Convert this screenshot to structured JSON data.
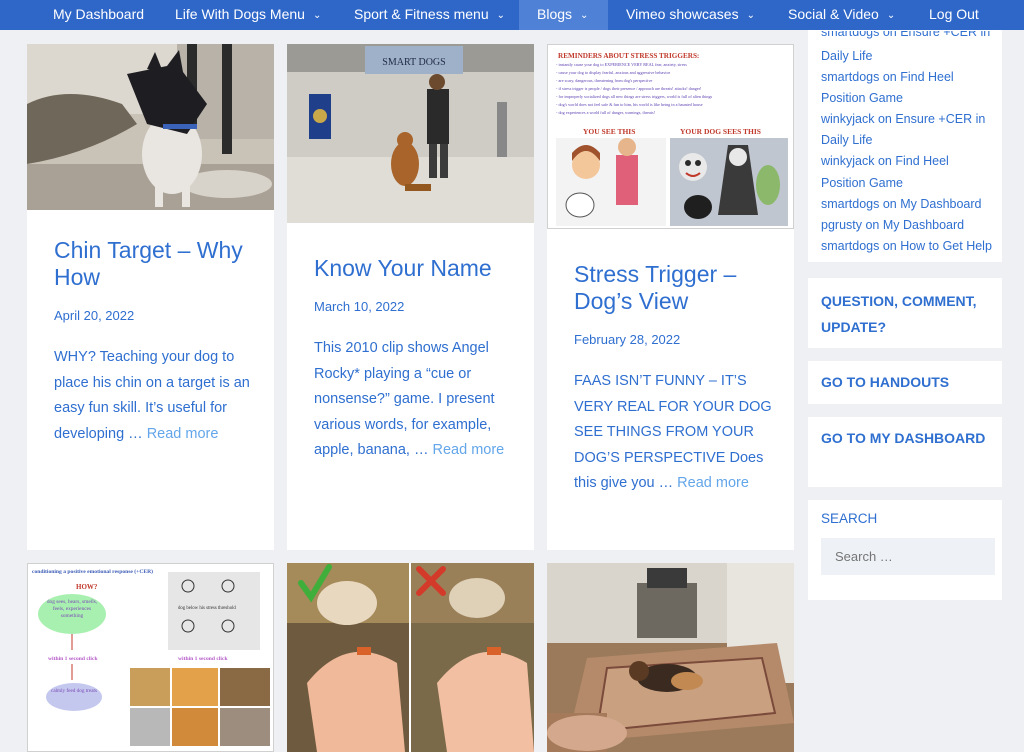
{
  "nav": {
    "items": [
      {
        "label": "My Dashboard"
      },
      {
        "label": "Life With Dogs Menu",
        "dropdown": true
      },
      {
        "label": "Sport & Fitness menu",
        "dropdown": true
      },
      {
        "label": "Blogs",
        "dropdown": true,
        "active": true
      },
      {
        "label": "Vimeo showcases",
        "dropdown": true
      },
      {
        "label": "Social & Video",
        "dropdown": true
      },
      {
        "label": "Log Out"
      }
    ],
    "chevron": "⌄"
  },
  "posts": [
    {
      "title": "Chin Target – Why How",
      "date": "April 20, 2022",
      "excerpt": "WHY? Teaching your dog to place his chin on a target is an easy fun skill. It’s useful for developing … ",
      "read_more": "Read more"
    },
    {
      "title": "Know Your Name",
      "date": "March 10, 2022",
      "excerpt": "This 2010 clip shows Angel Rocky* playing a “cue or nonsense?” game. I present various words, for example, apple, banana, … ",
      "read_more": "Read more",
      "image_text": {
        "sign": "SMART DOGS"
      }
    },
    {
      "title": "Stress Trigger – Dog’s View",
      "date": "February 28, 2022",
      "excerpt": "FAAS ISN’T FUNNY – IT’S VERY REAL FOR YOUR DOG SEE THINGS FROM YOUR DOG’S PERSPECTIVE Does this give you … ",
      "read_more": "Read more",
      "image_text": {
        "heading": "REMINDERS ABOUT STRESS TRIGGERS:",
        "bullets": [
          "- instantly cause your dog to EXPERIENCE VERY REAL fear, anxiety, stress",
          "- cause your dog to display fearful, anxious and aggressive behavior",
          "- are scary, dangerous, threatening from dog's perspective",
          "- if stress trigger is people / dogs their presence / approach are threats! attacks! danger!",
          "- for improperly socialized dogs all new things are stress triggers, world is full of alien things",
          "- dog's world does not feel safe & fun to him, his world is like being in a haunted house",
          "- dog experiences a world full of danger, warnings, threats!"
        ],
        "left_caption": "YOU SEE THIS",
        "right_caption": "YOUR DOG SEES THIS"
      }
    },
    {
      "image_text": {
        "heading": "conditioning a positive emotional response (+CER)",
        "how": "HOW?",
        "bubble": "dog sees, hears, smells, feels, experiences something",
        "threshold": "dog below his stress threshold",
        "click1": "within 1 second click",
        "click2": "within 1 second click",
        "treat": "calmly feed dog treats"
      }
    },
    {},
    {}
  ],
  "sidebar": {
    "recent_comments": [
      "smartdogs on Ensure +CER in",
      "Daily Life",
      "smartdogs on Find Heel",
      "Position Game",
      "winkyjack on Ensure +CER in",
      "Daily Life",
      "winkyjack on Find Heel",
      "Position Game",
      "smartdogs on My Dashboard",
      "pgrusty on My Dashboard",
      "smartdogs on How to Get Help"
    ],
    "question_link": "QUESTION, COMMENT, UPDATE?",
    "handouts_link": "GO TO HANDOUTS",
    "dashboard_link": "GO TO MY DASHBOARD",
    "search_label": "SEARCH",
    "search_placeholder": "Search …"
  },
  "colors": {
    "nav_bg": "#2f67c9",
    "nav_active": "#4f82d6",
    "link": "#2f6fd0",
    "read_more": "#63a6ea",
    "page_bg": "#eef0f3"
  }
}
